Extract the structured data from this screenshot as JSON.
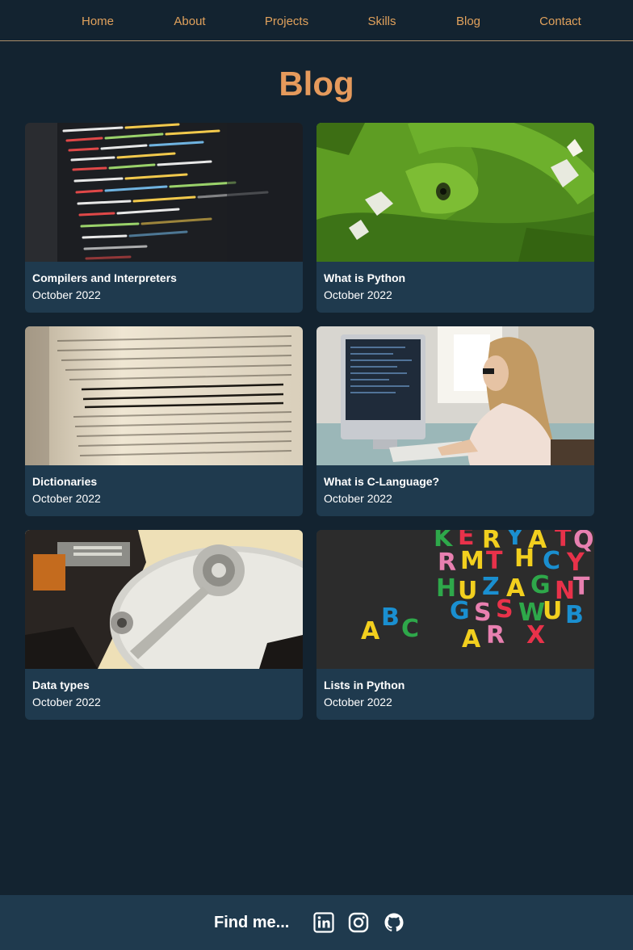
{
  "nav": {
    "items": [
      {
        "label": "Home"
      },
      {
        "label": "About"
      },
      {
        "label": "Projects"
      },
      {
        "label": "Skills"
      },
      {
        "label": "Blog"
      },
      {
        "label": "Contact"
      }
    ]
  },
  "page": {
    "title": "Blog"
  },
  "posts": [
    {
      "title": "Compilers and Interpreters",
      "date": "October 2022",
      "image": "code-screen-image"
    },
    {
      "title": "What is Python",
      "date": "October 2022",
      "image": "green-python-snake-image"
    },
    {
      "title": "Dictionaries",
      "date": "October 2022",
      "image": "dictionary-book-image"
    },
    {
      "title": "What is C-Language?",
      "date": "October 2022",
      "image": "woman-at-computer-image"
    },
    {
      "title": "Data types",
      "date": "October 2022",
      "image": "hard-drive-image"
    },
    {
      "title": "Lists in Python",
      "date": "October 2022",
      "image": "colorful-letters-image"
    }
  ],
  "footer": {
    "find_label": "Find me...",
    "social": [
      {
        "name": "linkedin-icon"
      },
      {
        "name": "instagram-icon"
      },
      {
        "name": "github-icon"
      }
    ]
  },
  "colors": {
    "background": "#132330",
    "card": "#1f3a4e",
    "accent": "#e59a5c",
    "nav_text": "#e0a15c"
  }
}
